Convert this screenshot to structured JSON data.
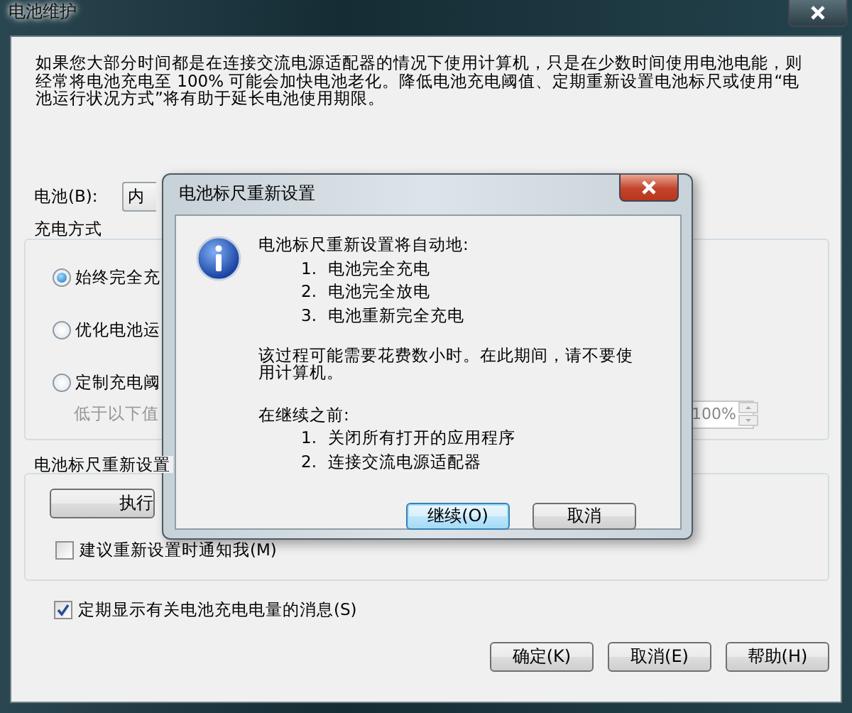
{
  "window": {
    "title": "电池维护"
  },
  "intro": "如果您大部分时间都是在连接交流电源适配器的情况下使用计算机，只是在少数时间使用电池电能，则经常将电池充电至 100% 可能会加快电池老化。降低电池充电阈值、定期重新设置电池标尺或使用“电池运行状况方式”将有助于延长电池使用期限。",
  "battery": {
    "label": "电池(B):",
    "value": "内"
  },
  "charging_group": {
    "title": "充电方式",
    "options": [
      {
        "label": "始终完全充",
        "selected": true
      },
      {
        "label": "优化电池运",
        "selected": false
      },
      {
        "label": "定制充电阈",
        "selected": false
      }
    ],
    "threshold": {
      "label": "低于以下值",
      "value": "100%",
      "disabled": true
    }
  },
  "calibration_group": {
    "title": "电池标尺重新设置",
    "button": "执行",
    "notify": {
      "label": "建议重新设置时通知我(M)",
      "checked": false
    }
  },
  "show_messages": {
    "label": "定期显示有关电池充电电量的消息(S)",
    "checked": true
  },
  "buttons": [
    "确定(K)",
    "取消(E)",
    "帮助(H)"
  ],
  "dialog": {
    "title": "电池标尺重新设置",
    "heading": "电池标尺重新设置将自动地:",
    "steps": [
      {
        "number": "1.",
        "text": "电池完全充电"
      },
      {
        "number": "2.",
        "text": "电池完全放电"
      },
      {
        "number": "3.",
        "text": "电池重新完全充电"
      }
    ],
    "note": "该过程可能需要花费数小时。在此期间，请不要使用计算机。",
    "before": "在继续之前:",
    "prep": [
      {
        "number": "1.",
        "text": "关闭所有打开的应用程序"
      },
      {
        "number": "2.",
        "text": "连接交流电源适配器"
      }
    ],
    "buttons": [
      {
        "label": "继续(O)",
        "default": true
      },
      {
        "label": "取消",
        "default": false
      }
    ]
  }
}
